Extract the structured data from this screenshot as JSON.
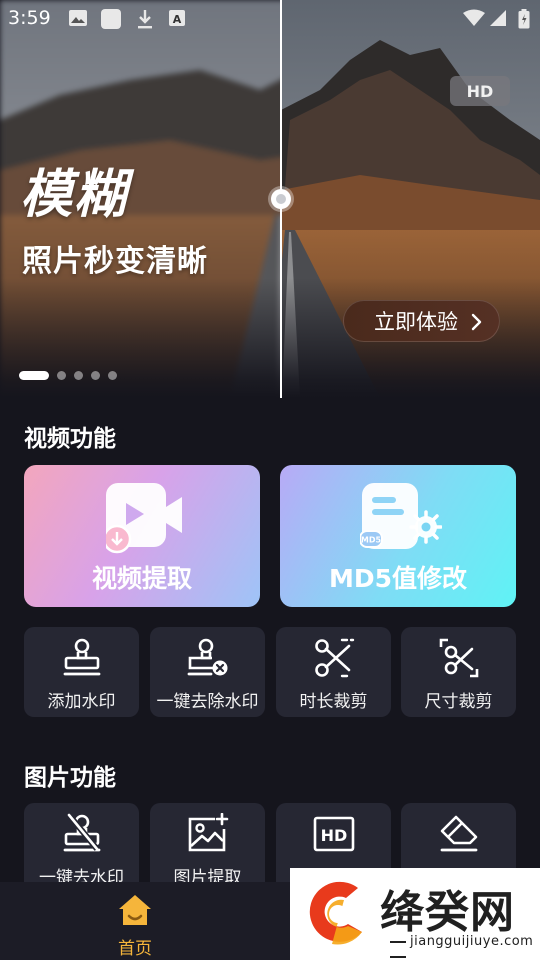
{
  "status_bar": {
    "time": "3:59",
    "left_icons": [
      "image-icon",
      "app-square-icon",
      "download-icon",
      "font-a-icon"
    ],
    "right_icons": [
      "wifi-icon",
      "signal-icon",
      "battery-icon"
    ]
  },
  "banner": {
    "title": "模糊",
    "subtitle": "照片秒变清晰",
    "hd_badge": "HD",
    "cta_label": "立即体验",
    "cta_icon": "chevron-right-icon",
    "page_count": 5,
    "active_page": 1
  },
  "video_section": {
    "title": "视频功能",
    "big_cards": [
      {
        "label": "视频提取",
        "icon": "video-extract-icon"
      },
      {
        "label": "MD5值修改",
        "icon": "md5-edit-icon"
      }
    ],
    "tools": [
      {
        "label": "添加水印",
        "icon": "stamp-icon"
      },
      {
        "label": "一键去除水印",
        "icon": "stamp-remove-icon"
      },
      {
        "label": "时长裁剪",
        "icon": "scissors-icon"
      },
      {
        "label": "尺寸裁剪",
        "icon": "crop-scissors-icon"
      }
    ]
  },
  "image_section": {
    "title": "图片功能",
    "tools": [
      {
        "label": "一键去水印",
        "icon": "stamp-strike-icon"
      },
      {
        "label": "图片提取",
        "icon": "image-add-icon"
      },
      {
        "label": "",
        "icon": "hd-icon"
      },
      {
        "label": "",
        "icon": "eraser-icon"
      }
    ]
  },
  "bottom_nav": {
    "home_label": "首页",
    "home_icon": "home-icon",
    "active_color": "#f5b53b"
  },
  "watermark": {
    "brand": "绛癸网",
    "url": "jiangguijiuye.com"
  },
  "colors": {
    "background": "#15151d",
    "card": "#262733",
    "accent": "#f5b53b"
  }
}
